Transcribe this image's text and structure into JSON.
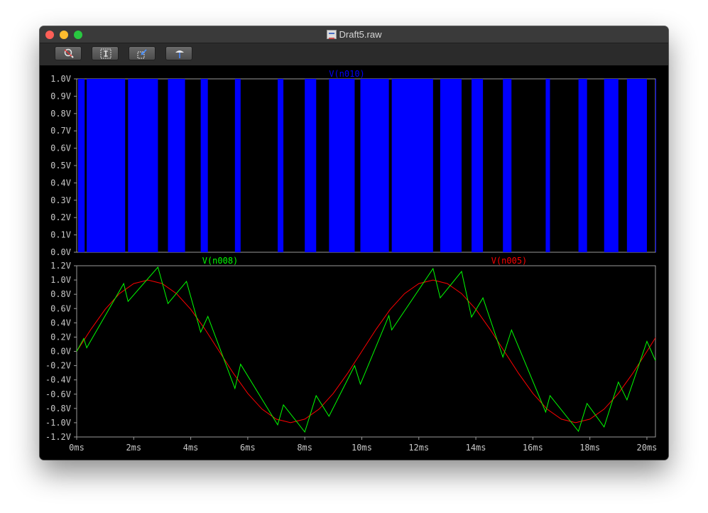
{
  "window": {
    "title": "Draft5.raw",
    "toolbar": [
      {
        "name": "zoom-icon"
      },
      {
        "name": "autorange-icon"
      },
      {
        "name": "zoom-back-icon"
      },
      {
        "name": "probe-icon"
      }
    ]
  },
  "chart_data": [
    {
      "type": "line",
      "title": "",
      "series": [
        {
          "name": "V(n010)",
          "color": "#0000ff"
        }
      ],
      "digital_step": true,
      "x_unit": "ms",
      "xlim": [
        0,
        20.3
      ],
      "ylim": [
        0,
        1.0
      ],
      "yticks": [
        "0.0V",
        "0.1V",
        "0.2V",
        "0.3V",
        "0.4V",
        "0.5V",
        "0.6V",
        "0.7V",
        "0.8V",
        "0.9V",
        "1.0V"
      ],
      "high_intervals_ms": [
        [
          0.05,
          0.28
        ],
        [
          0.35,
          1.7
        ],
        [
          1.8,
          2.85
        ],
        [
          3.2,
          3.8
        ],
        [
          4.35,
          4.6
        ],
        [
          5.55,
          5.75
        ],
        [
          7.05,
          7.25
        ],
        [
          8.0,
          8.4
        ],
        [
          8.85,
          9.75
        ],
        [
          9.95,
          10.95
        ],
        [
          11.05,
          12.5
        ],
        [
          12.75,
          13.5
        ],
        [
          13.85,
          14.25
        ],
        [
          14.95,
          15.25
        ],
        [
          16.45,
          16.6
        ],
        [
          17.6,
          17.9
        ],
        [
          18.5,
          19.0
        ],
        [
          19.3,
          20.0
        ],
        [
          20.3,
          20.3
        ]
      ]
    },
    {
      "type": "line",
      "title": "",
      "series": [
        {
          "name": "V(n008)",
          "color": "#00ff00",
          "x": [
            0,
            0.25,
            0.35,
            1.65,
            1.8,
            2.85,
            3.2,
            3.85,
            4.35,
            4.6,
            5.55,
            5.75,
            7.05,
            7.25,
            8.0,
            8.4,
            8.85,
            9.75,
            9.95,
            10.95,
            11.05,
            12.5,
            12.75,
            13.5,
            13.85,
            14.25,
            14.95,
            15.25,
            16.45,
            16.6,
            17.6,
            17.9,
            18.5,
            19.0,
            19.3,
            20.0,
            20.3
          ],
          "y": [
            0,
            0.18,
            0.05,
            0.95,
            0.7,
            1.18,
            0.67,
            0.98,
            0.27,
            0.49,
            -0.52,
            -0.18,
            -1.03,
            -0.75,
            -1.13,
            -0.62,
            -0.91,
            -0.2,
            -0.46,
            0.5,
            0.3,
            1.16,
            0.75,
            1.12,
            0.48,
            0.75,
            -0.08,
            0.3,
            -0.85,
            -0.62,
            -1.12,
            -0.73,
            -1.06,
            -0.43,
            -0.68,
            0.14,
            -0.13
          ]
        },
        {
          "name": "V(n005)",
          "color": "#ff0000",
          "x": [
            0,
            0.5,
            1.0,
            1.5,
            2.0,
            2.5,
            3.0,
            3.5,
            4.0,
            4.5,
            5.0,
            5.5,
            6.0,
            6.5,
            7.0,
            7.5,
            8.0,
            8.5,
            9.0,
            9.5,
            10.0,
            10.5,
            11.0,
            11.5,
            12.0,
            12.5,
            13.0,
            13.5,
            14.0,
            14.5,
            15.0,
            15.5,
            16.0,
            16.5,
            17.0,
            17.5,
            18.0,
            18.5,
            19.0,
            19.5,
            20.0,
            20.3
          ],
          "y": [
            0,
            0.31,
            0.59,
            0.81,
            0.95,
            1.0,
            0.95,
            0.81,
            0.59,
            0.31,
            0,
            -0.31,
            -0.59,
            -0.81,
            -0.95,
            -1.0,
            -0.95,
            -0.81,
            -0.59,
            -0.31,
            0,
            0.31,
            0.59,
            0.81,
            0.95,
            1.0,
            0.95,
            0.81,
            0.59,
            0.31,
            0,
            -0.31,
            -0.59,
            -0.81,
            -0.95,
            -1.0,
            -0.95,
            -0.81,
            -0.59,
            -0.31,
            0,
            0.19
          ]
        }
      ],
      "xlim": [
        0,
        20.3
      ],
      "ylim": [
        -1.2,
        1.2
      ],
      "yticks": [
        "-1.2V",
        "-1.0V",
        "-0.8V",
        "-0.6V",
        "-0.4V",
        "-0.2V",
        "0.0V",
        "0.2V",
        "0.4V",
        "0.6V",
        "0.8V",
        "1.0V",
        "1.2V"
      ],
      "xticks": [
        "0ms",
        "2ms",
        "4ms",
        "6ms",
        "8ms",
        "10ms",
        "12ms",
        "14ms",
        "16ms",
        "18ms",
        "20ms"
      ]
    }
  ],
  "colors": {
    "grid_frame": "#9a9a9a",
    "axis_text": "#c8c8c8",
    "background": "#000000"
  }
}
